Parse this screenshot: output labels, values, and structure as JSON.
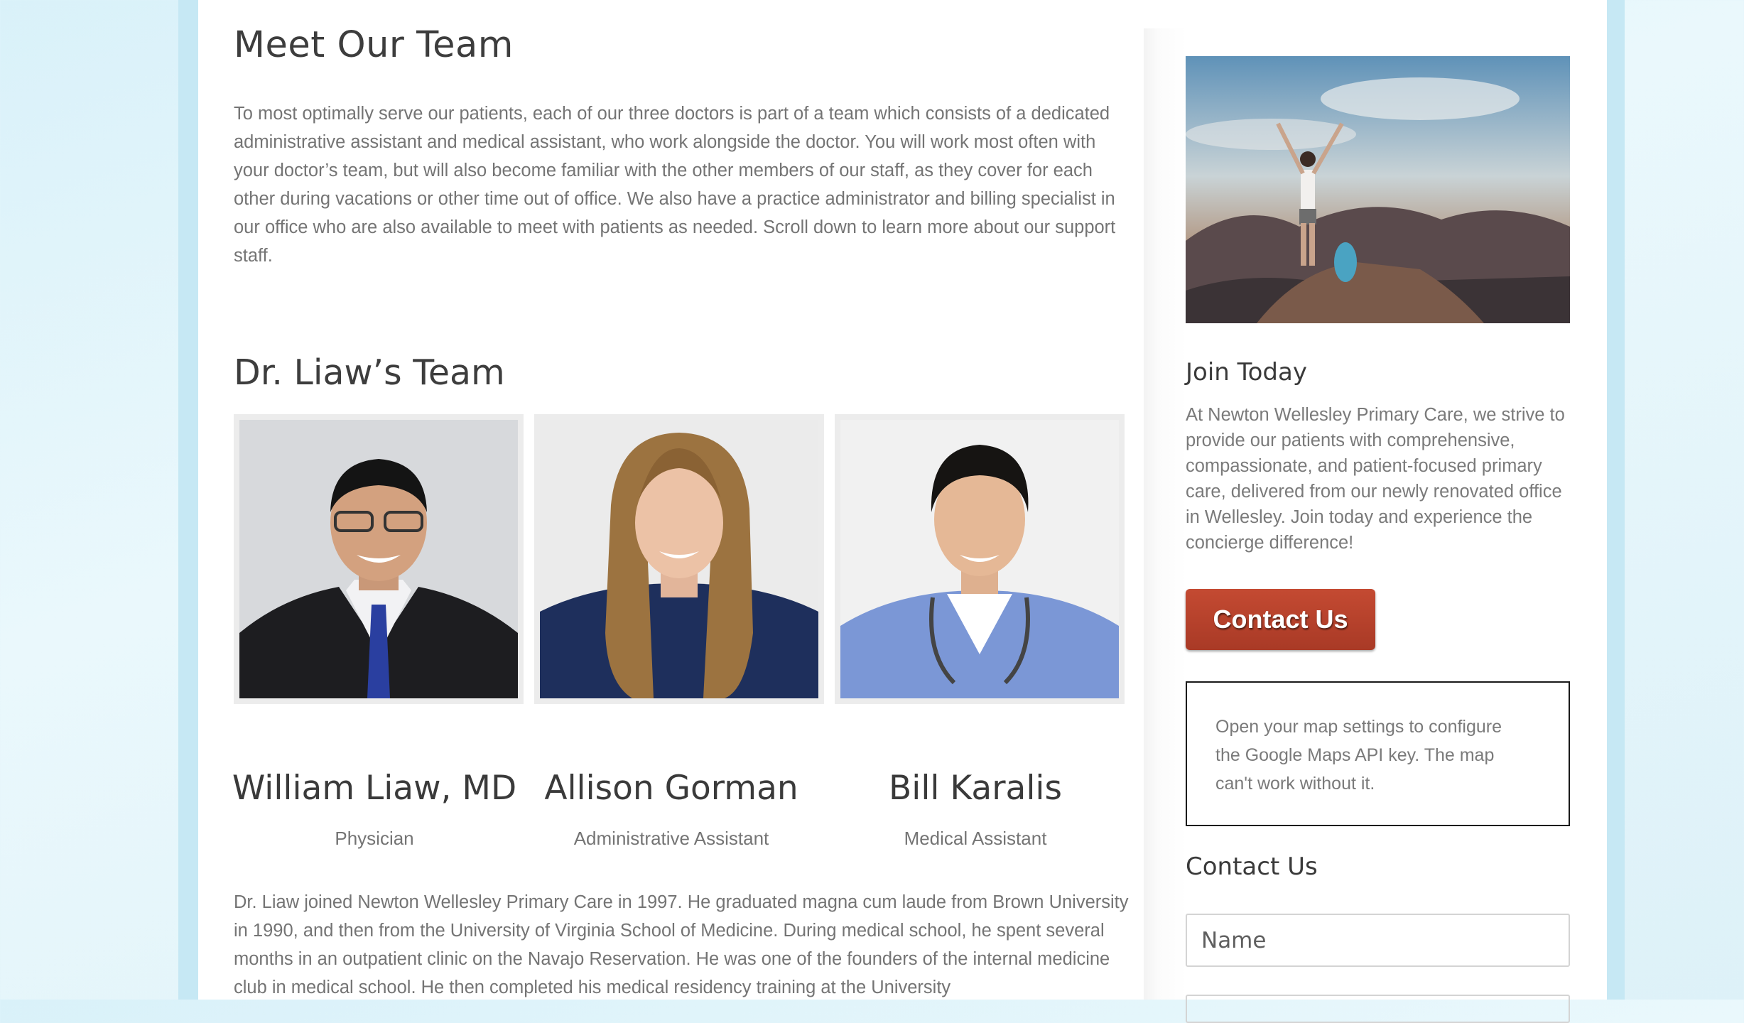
{
  "main": {
    "title": "Meet Our Team",
    "intro": "To most optimally serve our patients, each of our three doctors is part of a team which consists of a dedicated administrative assistant and medical assistant, who work alongside the doctor. You will work most often with your doctor’s team, but will also become familiar with the other members of our staff, as they cover for each other during vacations or other time out of office. We also have a practice administrator and billing specialist in our office who are also available to meet with patients as needed. Scroll down to learn more about our support staff.",
    "team_heading": "Dr. Liaw’s Team",
    "members": [
      {
        "name": "William Liaw, MD",
        "role": "Physician"
      },
      {
        "name": "Allison Gorman",
        "role": "Administrative Assistant"
      },
      {
        "name": "Bill Karalis",
        "role": "Medical Assistant"
      }
    ],
    "bio": "Dr. Liaw joined Newton Wellesley Primary Care in 1997. He graduated magna cum laude from Brown University in 1990, and then from the University of Virginia School of Medicine. During medical school, he spent several months in an outpatient clinic on the Navajo Reservation. He was one of the founders of the internal medicine club in medical school. He then completed his medical residency training at the University"
  },
  "sidebar": {
    "join_heading": "Join Today",
    "join_text": "At Newton Wellesley Primary Care, we strive to provide our patients with comprehensive, compassionate, and patient-focused primary care, delivered from our newly renovated office in Wellesley. Join today and experience the concierge difference!",
    "contact_button": "Contact Us",
    "map_notice": "Open your map settings to configure the Google Maps API key. The map can't work without it.",
    "contact_heading": "Contact Us",
    "name_placeholder": "Name"
  },
  "colors": {
    "band": "#c6e8f4",
    "button": "#b4402b",
    "heading": "#3d3d3d",
    "body_text": "#747474"
  }
}
